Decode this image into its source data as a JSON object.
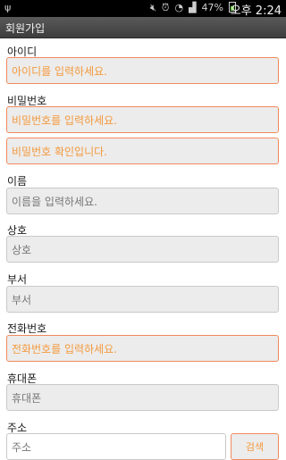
{
  "status_bar": {
    "usb_icon": "usb-icon",
    "battery_percent": "47%",
    "clock": "오후 2:24"
  },
  "titlebar": {
    "title": "회원가입"
  },
  "fields": {
    "id": {
      "label": "아이디",
      "placeholder": "아이디를 입력하세요."
    },
    "password": {
      "label": "비밀번호",
      "placeholder": "비밀번호를 입력하세요."
    },
    "password_confirm": {
      "placeholder": "비밀번호 확인입니다."
    },
    "name": {
      "label": "이름",
      "placeholder": "이름을 입력하세요."
    },
    "company": {
      "label": "상호",
      "placeholder": "상호"
    },
    "department": {
      "label": "부서",
      "placeholder": "부서"
    },
    "phone": {
      "label": "전화번호",
      "placeholder": "전화번호를 입력하세요."
    },
    "mobile": {
      "label": "휴대폰",
      "placeholder": "휴대폰"
    },
    "address": {
      "label": "주소",
      "placeholder": "주소",
      "search_label": "검색"
    }
  },
  "colors": {
    "error_border": "#f08a5d",
    "error_text": "#f39a3e",
    "field_bg": "#ececec"
  }
}
